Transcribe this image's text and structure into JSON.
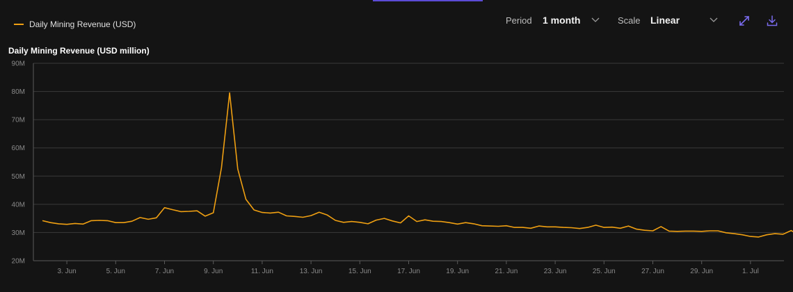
{
  "legend": {
    "label": "Daily Mining Revenue (USD)"
  },
  "controls": {
    "period_label": "Period",
    "period_value": "1 month",
    "scale_label": "Scale",
    "scale_value": "Linear",
    "expand_icon": "expand-icon",
    "download_icon": "download-icon"
  },
  "colors": {
    "series": "#f0a012",
    "accent": "#7b6cf0",
    "background": "#141414",
    "grid": "#3a3a3a"
  },
  "chart_data": {
    "type": "line",
    "title": "Daily Mining Revenue (USD million)",
    "xlabel": "",
    "ylabel": "",
    "ylim": [
      20,
      90
    ],
    "y_ticks": [
      "20M",
      "30M",
      "40M",
      "50M",
      "60M",
      "70M",
      "80M",
      "90M"
    ],
    "x_start": "2 Jun",
    "x_tick_labels": [
      "3. Jun",
      "5. Jun",
      "7. Jun",
      "9. Jun",
      "11. Jun",
      "13. Jun",
      "15. Jun",
      "17. Jun",
      "19. Jun",
      "21. Jun",
      "23. Jun",
      "25. Jun",
      "27. Jun",
      "29. Jun",
      "1. Jul"
    ],
    "grid": true,
    "legend_position": "top-left",
    "series": [
      {
        "name": "Daily Mining Revenue (USD)",
        "values": [
          34.2,
          33.5,
          33.1,
          32.9,
          33.2,
          33.0,
          34.2,
          34.3,
          34.2,
          33.5,
          33.5,
          34.0,
          35.3,
          34.7,
          35.2,
          38.8,
          38.1,
          37.4,
          37.5,
          37.7,
          35.8,
          37.0,
          53.0,
          79.5,
          52.5,
          41.8,
          38.0,
          37.1,
          36.9,
          37.2,
          35.9,
          35.7,
          35.4,
          36.0,
          37.2,
          36.2,
          34.3,
          33.6,
          33.9,
          33.6,
          33.1,
          34.4,
          35.0,
          34.1,
          33.4,
          35.9,
          33.9,
          34.5,
          34.0,
          33.9,
          33.5,
          33.0,
          33.5,
          33.1,
          32.4,
          32.3,
          32.2,
          32.4,
          31.8,
          31.8,
          31.5,
          32.3,
          32.0,
          32.0,
          31.8,
          31.7,
          31.4,
          31.8,
          32.6,
          31.8,
          31.9,
          31.5,
          32.3,
          31.2,
          30.8,
          30.6,
          32.1,
          30.5,
          30.4,
          30.5,
          30.5,
          30.4,
          30.6,
          30.6,
          29.9,
          29.6,
          29.2,
          28.6,
          28.4,
          29.2,
          29.6,
          29.4,
          30.7,
          29.0,
          29.6,
          29.0,
          28.7,
          29.1,
          29.2,
          29.3,
          29.2,
          29.0,
          28.6,
          28.5,
          28.6,
          28.6,
          28.6,
          28.5,
          28.8,
          29.1,
          29.3,
          29.6,
          29.9
        ]
      }
    ]
  }
}
